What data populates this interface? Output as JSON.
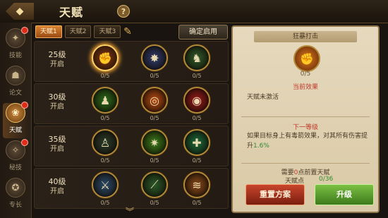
{
  "header": {
    "title": "天赋",
    "help": "?",
    "back": "◆"
  },
  "sidebar": {
    "items": [
      {
        "label": "技能",
        "icon": "skill-icon",
        "glyph": "✦",
        "dot": true,
        "active": false
      },
      {
        "label": "论文",
        "icon": "scroll-icon",
        "glyph": "☗",
        "dot": false,
        "active": false
      },
      {
        "label": "天赋",
        "icon": "talent-icon",
        "glyph": "❀",
        "dot": true,
        "active": true
      },
      {
        "label": "秘技",
        "icon": "secret-icon",
        "glyph": "✧",
        "dot": true,
        "active": false
      },
      {
        "label": "专长",
        "icon": "specialty-icon",
        "glyph": "✪",
        "dot": false,
        "active": false
      }
    ]
  },
  "tabs": [
    {
      "label": "天赋1",
      "active": true
    },
    {
      "label": "天赋2",
      "active": false
    },
    {
      "label": "天赋3",
      "active": false
    }
  ],
  "toolbar": {
    "edit_icon": "✎",
    "confirm_label": "确定启用"
  },
  "rows": [
    {
      "level": "25级",
      "sub": "开启",
      "skills": [
        {
          "icon": "fist-icon",
          "glyph": "✊",
          "count": "0/5",
          "bg": "#8a3a12",
          "selected": true
        },
        {
          "icon": "bird-icon",
          "glyph": "✸",
          "count": "0/5",
          "bg": "#2f3a6a",
          "selected": false
        },
        {
          "icon": "beast-icon",
          "glyph": "♞",
          "count": "0/5",
          "bg": "#2f5a2a",
          "selected": false
        }
      ]
    },
    {
      "level": "30级",
      "sub": "开启",
      "skills": [
        {
          "icon": "runner-icon",
          "glyph": "♟",
          "count": "0/5",
          "bg": "#2a6a1a",
          "selected": false
        },
        {
          "icon": "target-icon",
          "glyph": "◎",
          "count": "0/5",
          "bg": "#b84a12",
          "selected": false
        },
        {
          "icon": "eye-icon",
          "glyph": "◉",
          "count": "0/5",
          "bg": "#9a1a1a",
          "selected": false
        }
      ]
    },
    {
      "level": "35级",
      "sub": "开启",
      "skills": [
        {
          "icon": "shadow-icon",
          "glyph": "♙",
          "count": "0/5",
          "bg": "#2a3a2a",
          "selected": false
        },
        {
          "icon": "kick-icon",
          "glyph": "✷",
          "count": "0/5",
          "bg": "#3a7a1a",
          "selected": false
        },
        {
          "icon": "heal-icon",
          "glyph": "✚",
          "count": "0/5",
          "bg": "#1a6a3a",
          "selected": false
        }
      ]
    },
    {
      "level": "40级",
      "sub": "开启",
      "skills": [
        {
          "icon": "warrior-icon",
          "glyph": "⚔",
          "count": "0/5",
          "bg": "#2a4a6a",
          "selected": false
        },
        {
          "icon": "blade-icon",
          "glyph": "⟋",
          "count": "0/5",
          "bg": "#2a5a2a",
          "selected": false
        },
        {
          "icon": "claw-icon",
          "glyph": "≋",
          "count": "0/5",
          "bg": "#8a4a1a",
          "selected": false
        }
      ]
    }
  ],
  "more_chevron": "︾",
  "panel": {
    "title": "狂暴打击",
    "skill_icon": "fist-icon",
    "skill_glyph": "✊",
    "count": "0/5",
    "current_head": "当前效果",
    "current_body": "天赋未激活",
    "next_head": "下一等级",
    "next_body_prefix": "如果目标身上有毒箭效果，对其所有伤害提升",
    "next_body_value": "1.6%",
    "req_prefix": "需要",
    "req_value": "0",
    "req_suffix": "点前置天赋",
    "points_label": "天赋点",
    "points_value": "0/36",
    "reset_label": "重置方案",
    "upgrade_label": "升级"
  }
}
